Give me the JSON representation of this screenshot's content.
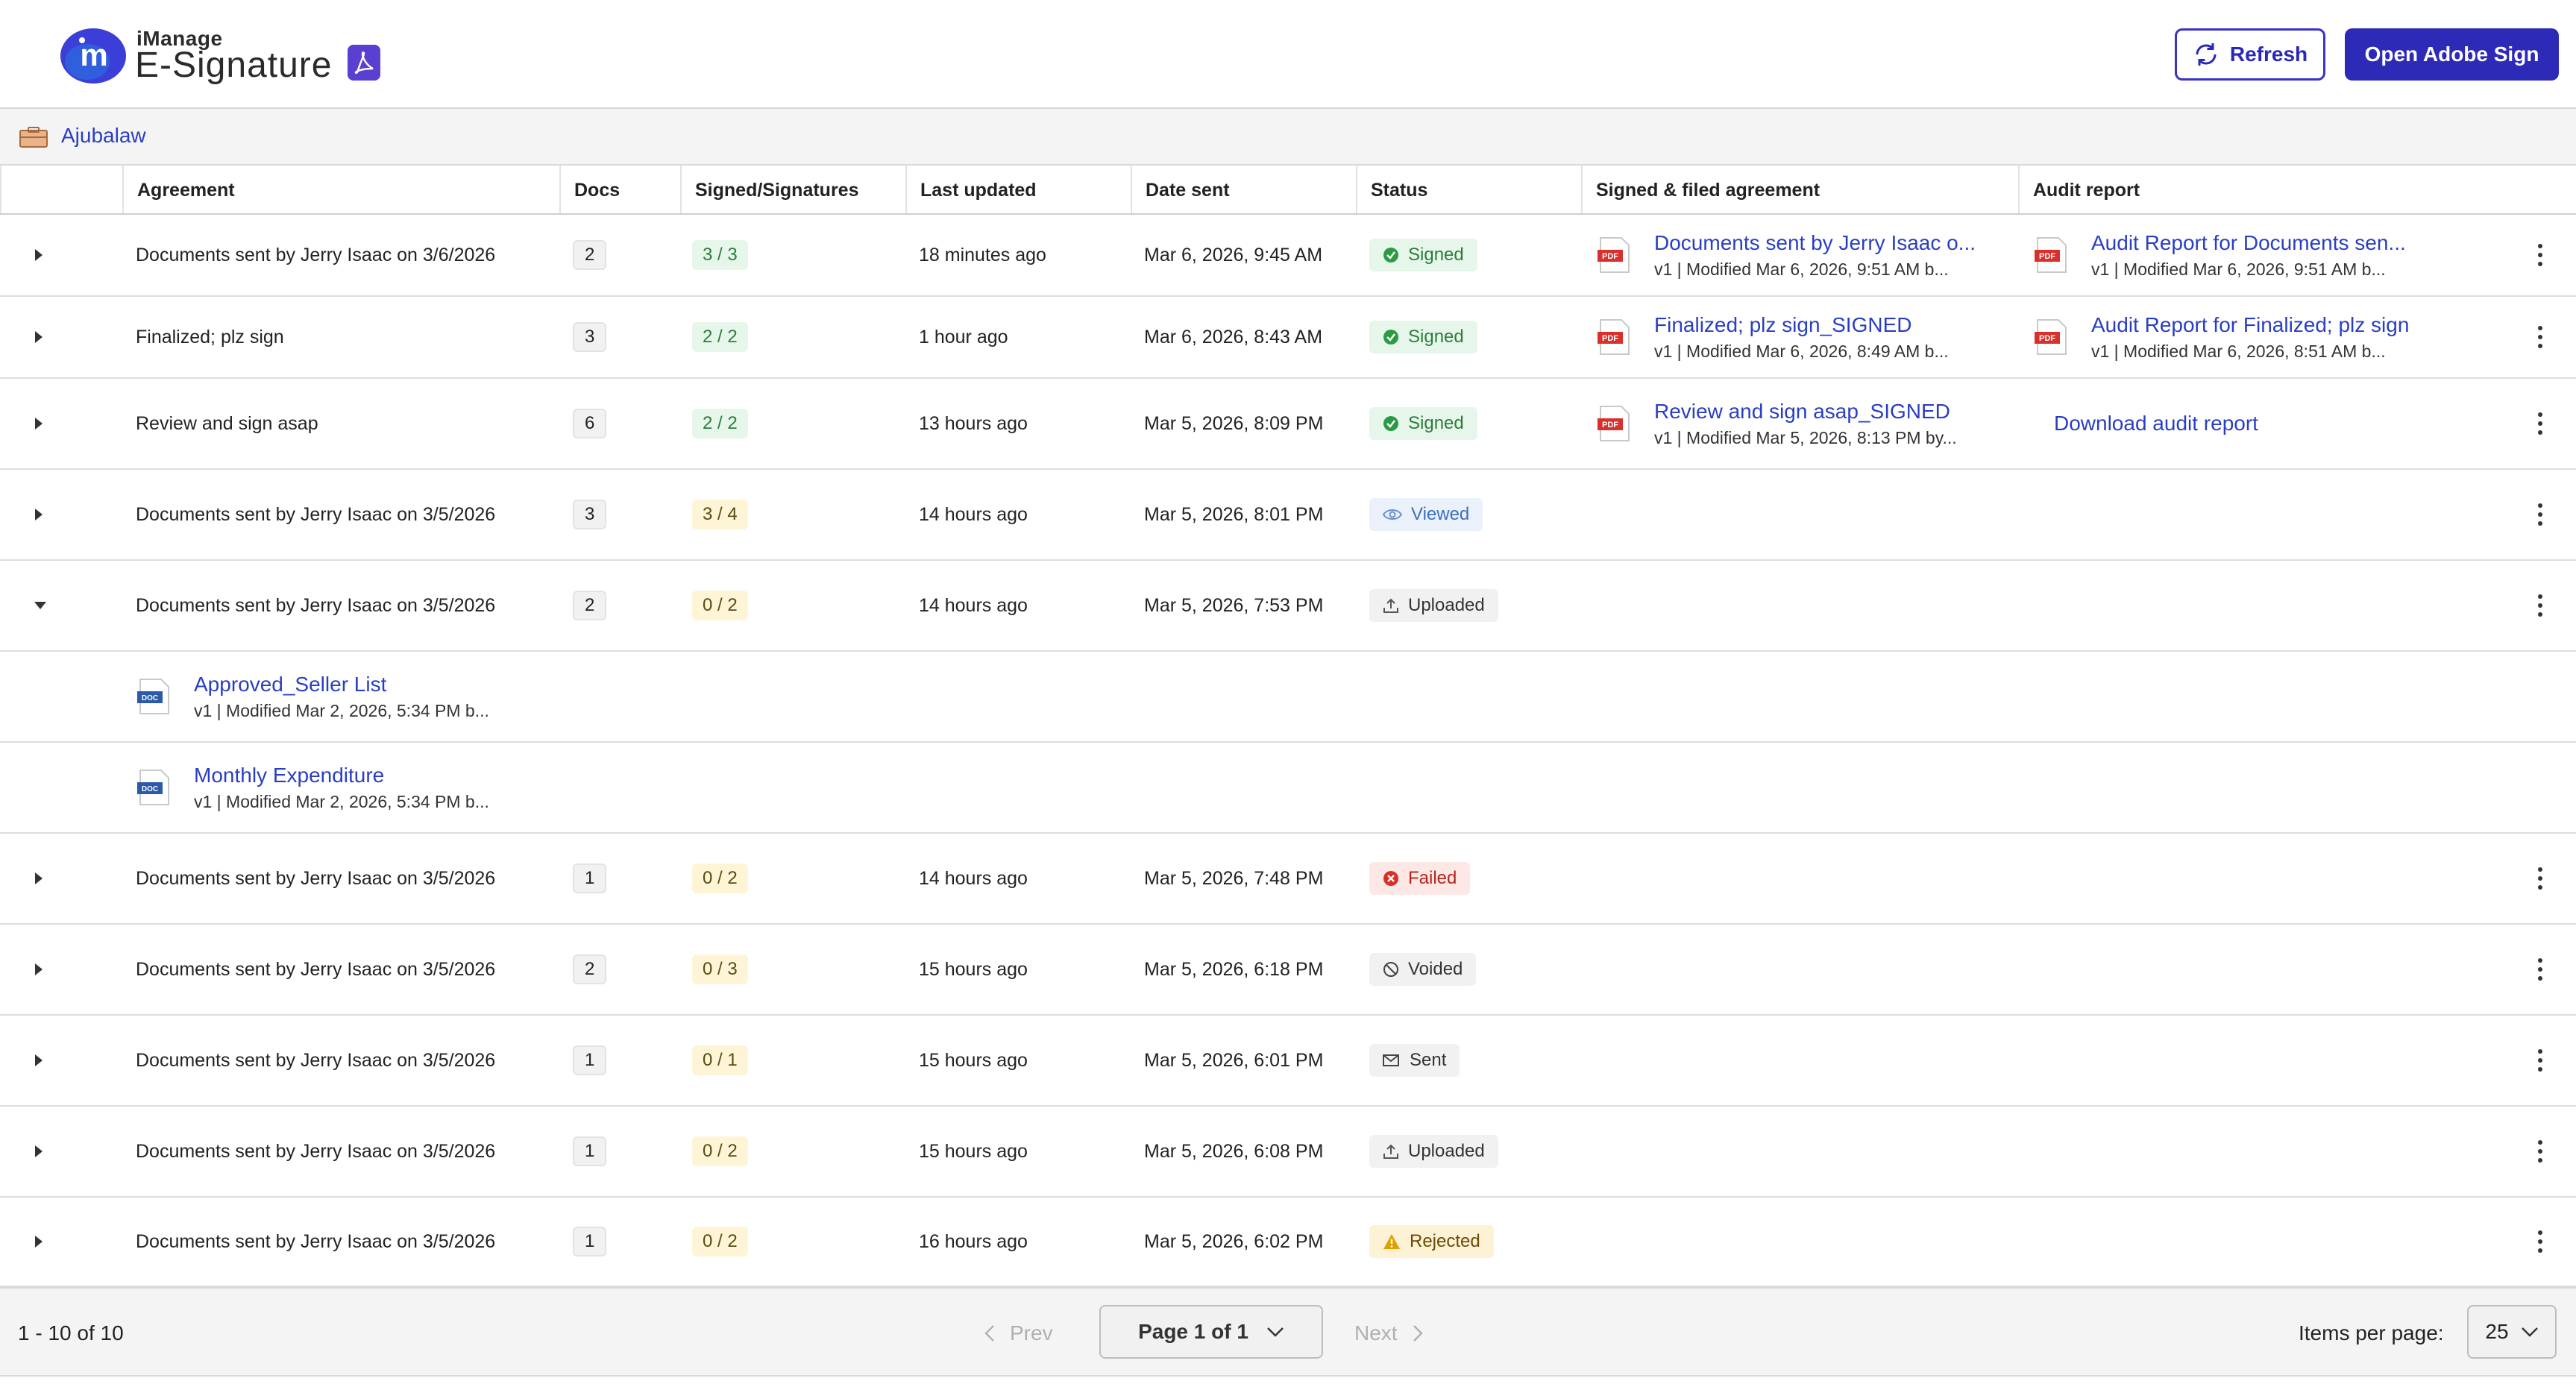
{
  "header": {
    "brand_small": "iManage",
    "brand_title": "E-Signature",
    "refresh_label": "Refresh",
    "open_adobe_label": "Open Adobe Sign"
  },
  "breadcrumb": {
    "label": "Ajubalaw"
  },
  "columns": [
    "Agreement",
    "Docs",
    "Signed/Signatures",
    "Last updated",
    "Date sent",
    "Status",
    "Signed & filed agreement",
    "Audit report"
  ],
  "rows": [
    {
      "agreement": "Documents sent by Jerry Isaac on 3/6/2026",
      "docs": "2",
      "signed": "3 / 3",
      "updated": "18 minutes ago",
      "sent": "Mar 6, 2026, 9:45 AM",
      "status": "Signed",
      "filed_title": "Documents sent by Jerry Isaac o...",
      "filed_sub": "v1 | Modified Mar 6, 2026, 9:51 AM b...",
      "audit_title": "Audit Report for Documents sen...",
      "audit_sub": "v1 | Modified Mar 6, 2026, 9:51 AM b..."
    },
    {
      "agreement": "Finalized; plz sign",
      "docs": "3",
      "signed": "2 / 2",
      "updated": "1 hour ago",
      "sent": "Mar 6, 2026, 8:43 AM",
      "status": "Signed",
      "filed_title": "Finalized; plz sign_SIGNED",
      "filed_sub": "v1 | Modified Mar 6, 2026, 8:49 AM b...",
      "audit_title": "Audit Report for Finalized; plz sign",
      "audit_sub": "v1 | Modified Mar 6, 2026, 8:51 AM b..."
    },
    {
      "agreement": "Review and sign asap",
      "docs": "6",
      "signed": "2 / 2",
      "updated": "13 hours ago",
      "sent": "Mar 5, 2026, 8:09 PM",
      "status": "Signed",
      "filed_title": "Review and sign asap_SIGNED",
      "filed_sub": "v1 | Modified Mar 5, 2026, 8:13 PM by...",
      "audit_link": "Download audit report"
    },
    {
      "agreement": "Documents sent by Jerry Isaac on 3/5/2026",
      "docs": "3",
      "signed": "3 / 4",
      "updated": "14 hours ago",
      "sent": "Mar 5, 2026, 8:01 PM",
      "status": "Viewed"
    },
    {
      "agreement": "Documents sent by Jerry Isaac on 3/5/2026",
      "docs": "2",
      "signed": "0 / 2",
      "updated": "14 hours ago",
      "sent": "Mar 5, 2026, 7:53 PM",
      "status": "Uploaded"
    },
    {
      "agreement": "Documents sent by Jerry Isaac on 3/5/2026",
      "docs": "1",
      "signed": "0 / 2",
      "updated": "14 hours ago",
      "sent": "Mar 5, 2026, 7:48 PM",
      "status": "Failed"
    },
    {
      "agreement": "Documents sent by Jerry Isaac on 3/5/2026",
      "docs": "2",
      "signed": "0 / 3",
      "updated": "15 hours ago",
      "sent": "Mar 5, 2026, 6:18 PM",
      "status": "Voided"
    },
    {
      "agreement": "Documents sent by Jerry Isaac on 3/5/2026",
      "docs": "1",
      "signed": "0 / 1",
      "updated": "15 hours ago",
      "sent": "Mar 5, 2026, 6:01 PM",
      "status": "Sent"
    },
    {
      "agreement": "Documents sent by Jerry Isaac on 3/5/2026",
      "docs": "1",
      "signed": "0 / 2",
      "updated": "15 hours ago",
      "sent": "Mar 5, 2026, 6:08 PM",
      "status": "Uploaded"
    },
    {
      "agreement": "Documents sent by Jerry Isaac on 3/5/2026",
      "docs": "1",
      "signed": "0 / 2",
      "updated": "16 hours ago",
      "sent": "Mar 5, 2026, 6:02 PM",
      "status": "Rejected"
    }
  ],
  "expanded_docs": [
    {
      "title": "Approved_Seller List",
      "sub": "v1 | Modified Mar 2, 2026, 5:34 PM b..."
    },
    {
      "title": "Monthly Expenditure",
      "sub": "v1 | Modified Mar 2, 2026, 5:34 PM b..."
    }
  ],
  "footer": {
    "range": "1 - 10 of 10",
    "prev": "Prev",
    "page": "Page 1 of 1",
    "next": "Next",
    "items_per_page_label": "Items per page:",
    "items_per_page": "25"
  },
  "colors": {
    "accent": "#2e2ab8",
    "link": "#2a3ec4",
    "signed": "#2b7d3a",
    "failed": "#b3261e",
    "rejected": "#e0a100",
    "viewed": "#3d6fbf"
  }
}
